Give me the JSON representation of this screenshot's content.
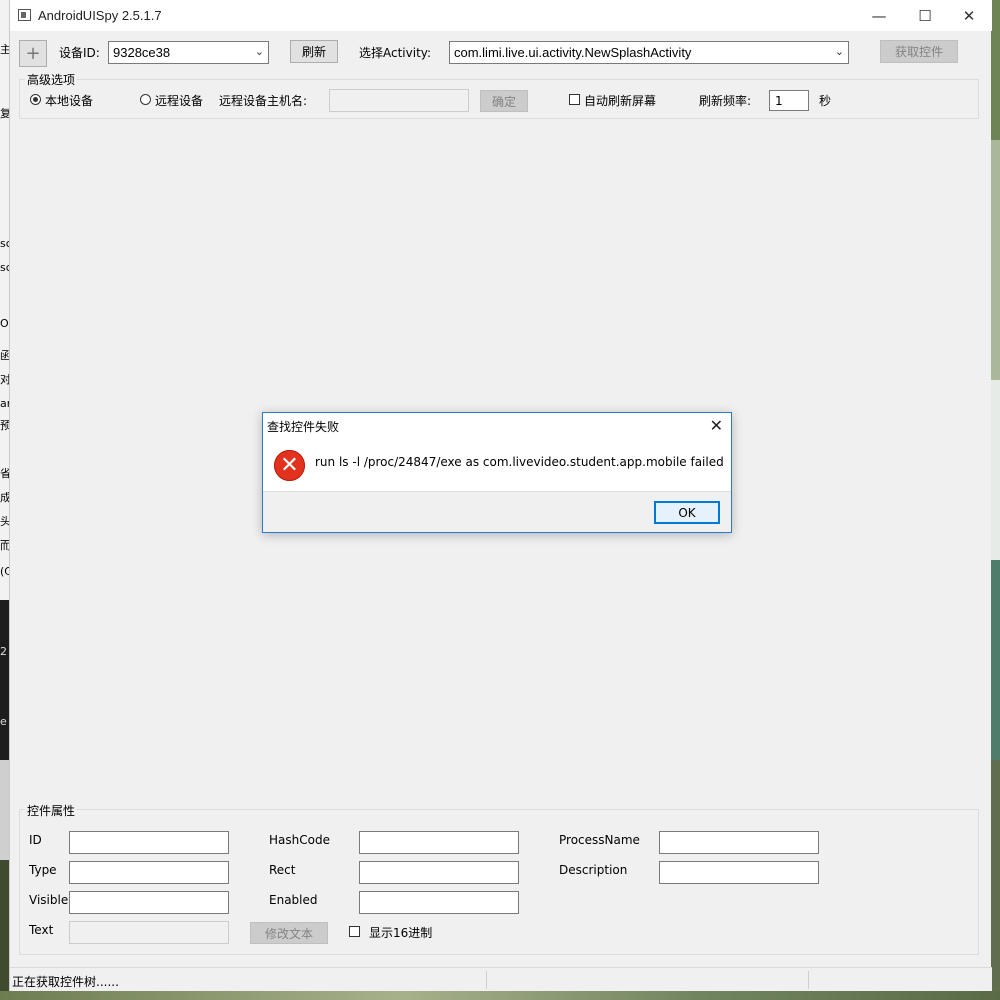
{
  "window": {
    "title": "AndroidUISpy 2.5.1.7",
    "controls": {
      "minimize": "—",
      "maximize": "☐",
      "close": "✕"
    }
  },
  "desktop_left_fragments": [
    "主",
    "复",
    "sc",
    "sc",
    "Or",
    "函",
    "对",
    "ar",
    "预",
    "省",
    "成",
    "头",
    "而",
    "(C",
    "2",
    "e"
  ],
  "toolbar": {
    "add_label": "+",
    "device_id_label": "设备ID:",
    "device_id_value": "9328ce38",
    "refresh_label": "刷新",
    "activity_label": "选择Activity:",
    "activity_value": "com.limi.live.ui.activity.NewSplashActivity",
    "get_controls_label": "获取控件"
  },
  "advanced": {
    "title": "高级选项",
    "local_device_label": "本地设备",
    "remote_device_label": "远程设备",
    "remote_host_label": "远程设备主机名:",
    "remote_host_value": "",
    "confirm_label": "确定",
    "auto_refresh_label": "自动刷新屏幕",
    "refresh_rate_label": "刷新频率:",
    "refresh_rate_value": "1",
    "seconds_label": "秒",
    "local_selected": true,
    "auto_refresh_checked": false
  },
  "properties": {
    "title": "控件属性",
    "id_label": "ID",
    "type_label": "Type",
    "visible_label": "Visible",
    "text_label": "Text",
    "hashcode_label": "HashCode",
    "rect_label": "Rect",
    "enabled_label": "Enabled",
    "processname_label": "ProcessName",
    "description_label": "Description",
    "modify_text_label": "修改文本",
    "show_hex_label": "显示16进制",
    "show_hex_checked": false,
    "id_value": "",
    "type_value": "",
    "visible_value": "",
    "text_value": "",
    "hashcode_value": "",
    "rect_value": "",
    "enabled_value": "",
    "processname_value": "",
    "description_value": ""
  },
  "status": {
    "text": "正在获取控件树......"
  },
  "dialog": {
    "title": "查找控件失败",
    "message": "run ls -l /proc/24847/exe as com.livevideo.student.app.mobile failed",
    "ok_label": "OK",
    "close_glyph": "✕",
    "icon": "error-icon"
  },
  "colors": {
    "accent": "#0078d7",
    "error": "#e2321e",
    "window_bg": "#f0f0f0"
  }
}
